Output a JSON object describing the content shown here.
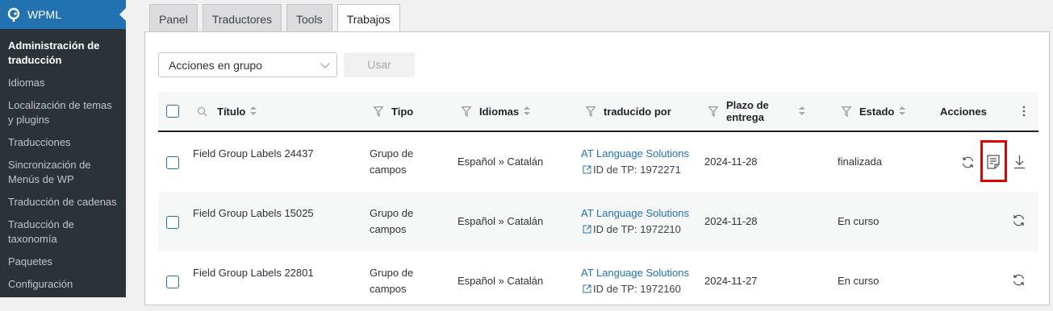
{
  "sidebar": {
    "app_title": "WPML",
    "items": [
      {
        "label": "Administración de traducción",
        "active": true
      },
      {
        "label": "Idiomas"
      },
      {
        "label": "Localización de temas y plugins"
      },
      {
        "label": "Traducciones"
      },
      {
        "label": "Sincronización de Menús de WP"
      },
      {
        "label": "Traducción de cadenas"
      },
      {
        "label": "Traducción de taxonomía"
      },
      {
        "label": "Paquetes"
      },
      {
        "label": "Configuración"
      }
    ]
  },
  "tabs": [
    {
      "label": "Panel"
    },
    {
      "label": "Traductores"
    },
    {
      "label": "Tools"
    },
    {
      "label": "Trabajos",
      "active": true
    }
  ],
  "toolbar": {
    "bulk_actions": "Acciones en grupo",
    "apply_label": "Usar"
  },
  "table": {
    "headers": {
      "title": "Título",
      "type": "Tipo",
      "languages": "Idiomas",
      "translated_by": "traducido por",
      "deadline": "Plazo de entrega",
      "status": "Estado",
      "actions": "Acciones"
    },
    "rows": [
      {
        "title": "Field Group Labels 24437",
        "type": "Grupo de campos",
        "languages": "Español » Catalán",
        "translator": "AT Language Solutions",
        "tp_id": "ID de TP: 1972271",
        "deadline": "2024-11-28",
        "status": "finalizada"
      },
      {
        "title": "Field Group Labels 15025",
        "type": "Grupo de campos",
        "languages": "Español » Catalán",
        "translator": "AT Language Solutions",
        "tp_id": "ID de TP: 1972210",
        "deadline": "2024-11-28",
        "status": "En curso"
      },
      {
        "title": "Field Group Labels 22801",
        "type": "Grupo de campos",
        "languages": "Español » Catalán",
        "translator": "AT Language Solutions",
        "tp_id": "ID de TP: 1972160",
        "deadline": "2024-11-27",
        "status": "En curso"
      }
    ]
  },
  "colors": {
    "highlight": "#e00000",
    "link": "#2271b1",
    "sidebar": "#2c3338",
    "wpml_header": "#2271b1"
  }
}
